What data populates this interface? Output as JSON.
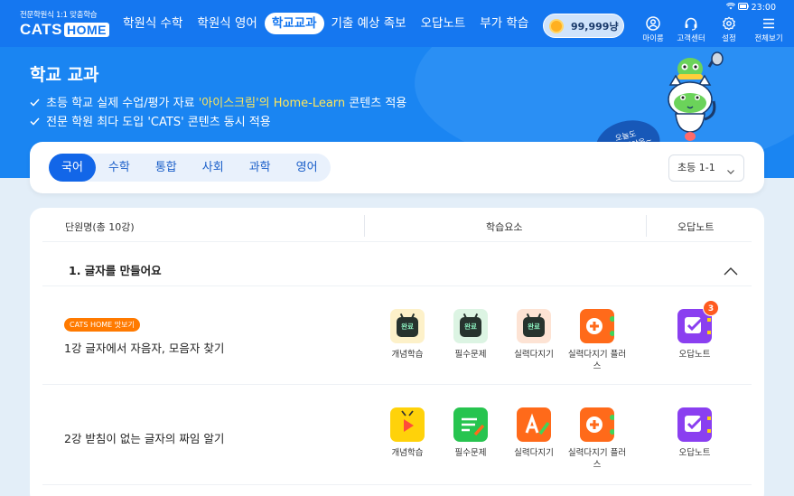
{
  "status": {
    "time": "23:00"
  },
  "logo": {
    "tagline": "전문학원식 1:1 맞춤학습",
    "brand": "CATS",
    "brand_suffix": "HOME"
  },
  "nav": {
    "items": [
      "학원식 수학",
      "학원식 영어",
      "학교교과",
      "기출 예상 족보",
      "오답노트",
      "부가 학습"
    ],
    "active_index": 2
  },
  "points": {
    "value": "99,999냥"
  },
  "tools": [
    "마이룸",
    "고객센터",
    "설정",
    "전체보기"
  ],
  "banner": {
    "title": "학교 교과",
    "line1_pre": "초등 학교 실제 수업/평가 자료 ",
    "line1_hl": "'아이스크림'의 Home-Learn",
    "line1_post": " 콘텐츠 적용",
    "line2": "전문 학원 최다 도입 'CATS' 콘텐츠 동시 적용",
    "bubble_line1": "오늘도",
    "bubble_line2": "파이팅이야옹~"
  },
  "subjects": {
    "tabs": [
      "국어",
      "수학",
      "통합",
      "사회",
      "과학",
      "영어"
    ],
    "active_index": 0
  },
  "grade_select": {
    "value": "초등 1-1"
  },
  "table": {
    "headers": [
      "단원명(총 10강)",
      "학습요소",
      "오답노트"
    ],
    "unit_title": "1. 글자를 만들어요",
    "lessons": [
      {
        "badge": "CATS HOME 맛보기",
        "title": "1강  글자에서 자음자, 모음자 찾기",
        "activities": [
          "개념학습",
          "필수문제",
          "실력다지기",
          "실력다지기 플러스"
        ],
        "done_label": "완료",
        "wrong_note": "오답노트",
        "wrong_count": "3"
      },
      {
        "title": "2강  받침이 없는 글자의 짜임 알기",
        "activities": [
          "개념학습",
          "필수문제",
          "실력다지기",
          "실력다지기 플러스"
        ],
        "wrong_note": "오답노트"
      }
    ]
  },
  "colors": {
    "primary": "#1577f0",
    "banner": "#1a85f2",
    "highlight": "#ffe65a",
    "badge": "#ff7a00",
    "purple": "#8a3ff0",
    "green": "#27c44f",
    "orange": "#ff6a1a",
    "yellow": "#ffd20a"
  }
}
